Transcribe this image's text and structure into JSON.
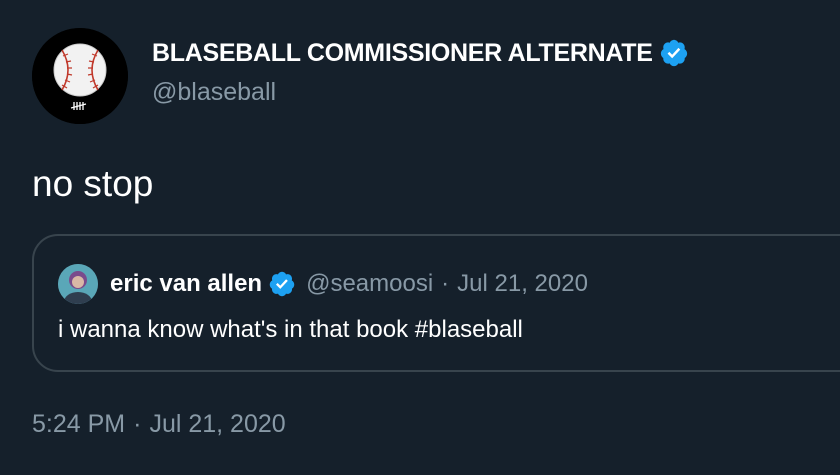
{
  "tweet": {
    "author": {
      "display_name": "BLASEBALL COMMISSIONER ALTERNATE",
      "handle": "@blaseball",
      "verified_icon": "verified-badge-icon",
      "avatar_icon": "baseball-tally-icon"
    },
    "text": "no stop",
    "time": "5:24 PM",
    "separator": "·",
    "date": "Jul 21, 2020"
  },
  "quoted_tweet": {
    "author": {
      "display_name": "eric van allen",
      "handle": "@seamoosi",
      "verified_icon": "verified-badge-icon",
      "avatar_icon": "profile-photo"
    },
    "separator": "·",
    "date": "Jul 21, 2020",
    "text": "i wanna know what's in that book #blaseball"
  },
  "colors": {
    "background": "#15202b",
    "text_primary": "#ffffff",
    "text_secondary": "#8899a6",
    "border": "#38444d",
    "verified": "#1da1f2"
  }
}
